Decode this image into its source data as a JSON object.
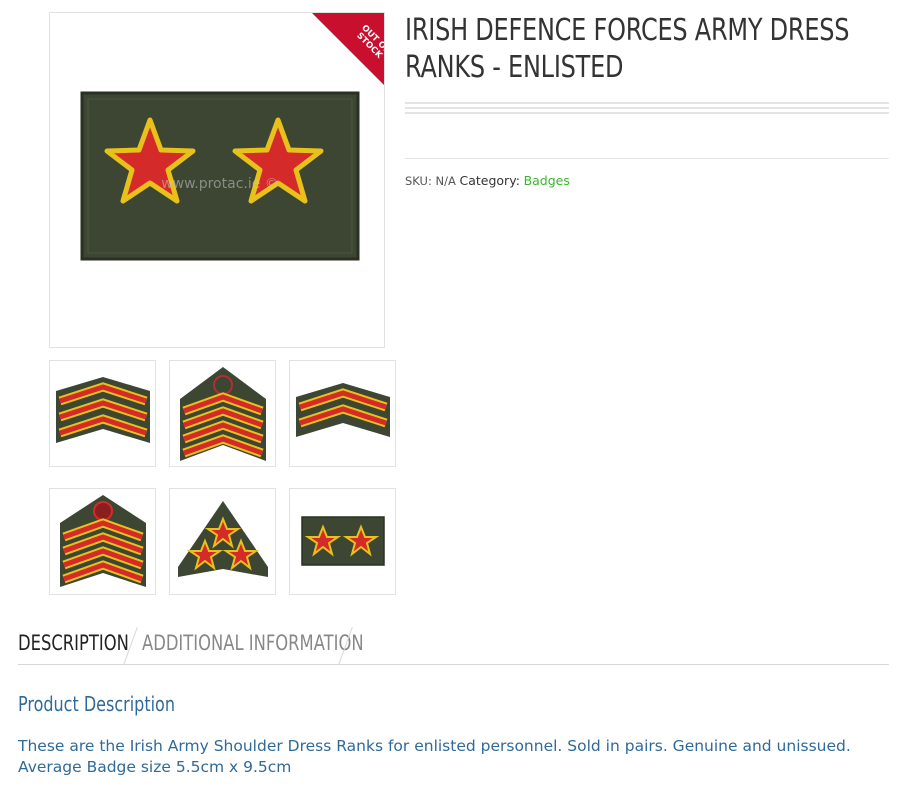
{
  "product": {
    "badge": "OUT OF STOCK",
    "title_line1": "IRISH DEFENCE FORCES ARMY DRESS",
    "title_line2": "RANKS - ENLISTED",
    "sku_label": "SKU:",
    "sku_value": "N/A",
    "category_label": "Category:",
    "category_value": "Badges",
    "watermark": "www.protac.ie ©"
  },
  "gallery": {
    "thumbnails": [
      {
        "type": "chevron-3"
      },
      {
        "type": "chevron-4-crest"
      },
      {
        "type": "chevron-2"
      },
      {
        "type": "chevron-4-emblem"
      },
      {
        "type": "triangle-3-stars"
      },
      {
        "type": "rect-2-stars"
      }
    ]
  },
  "tabs": [
    {
      "label": "DESCRIPTION",
      "active": true
    },
    {
      "label": "ADDITIONAL INFORMATION",
      "active": false
    }
  ],
  "description": {
    "heading": "Product Description",
    "line1": "These are the Irish Army Shoulder Dress Ranks for enlisted personnel. Sold in pairs. Genuine and unissued.",
    "line2": "Average Badge size 5.5cm x 9.5cm"
  },
  "colors": {
    "patch_green": "#3c4632",
    "stripe_gold": "#e8c21a",
    "stripe_red": "#d42a2a",
    "accent_green": "#3bb52e",
    "heading_blue": "#2f6a9a",
    "ribbon_red": "#c8102e"
  }
}
